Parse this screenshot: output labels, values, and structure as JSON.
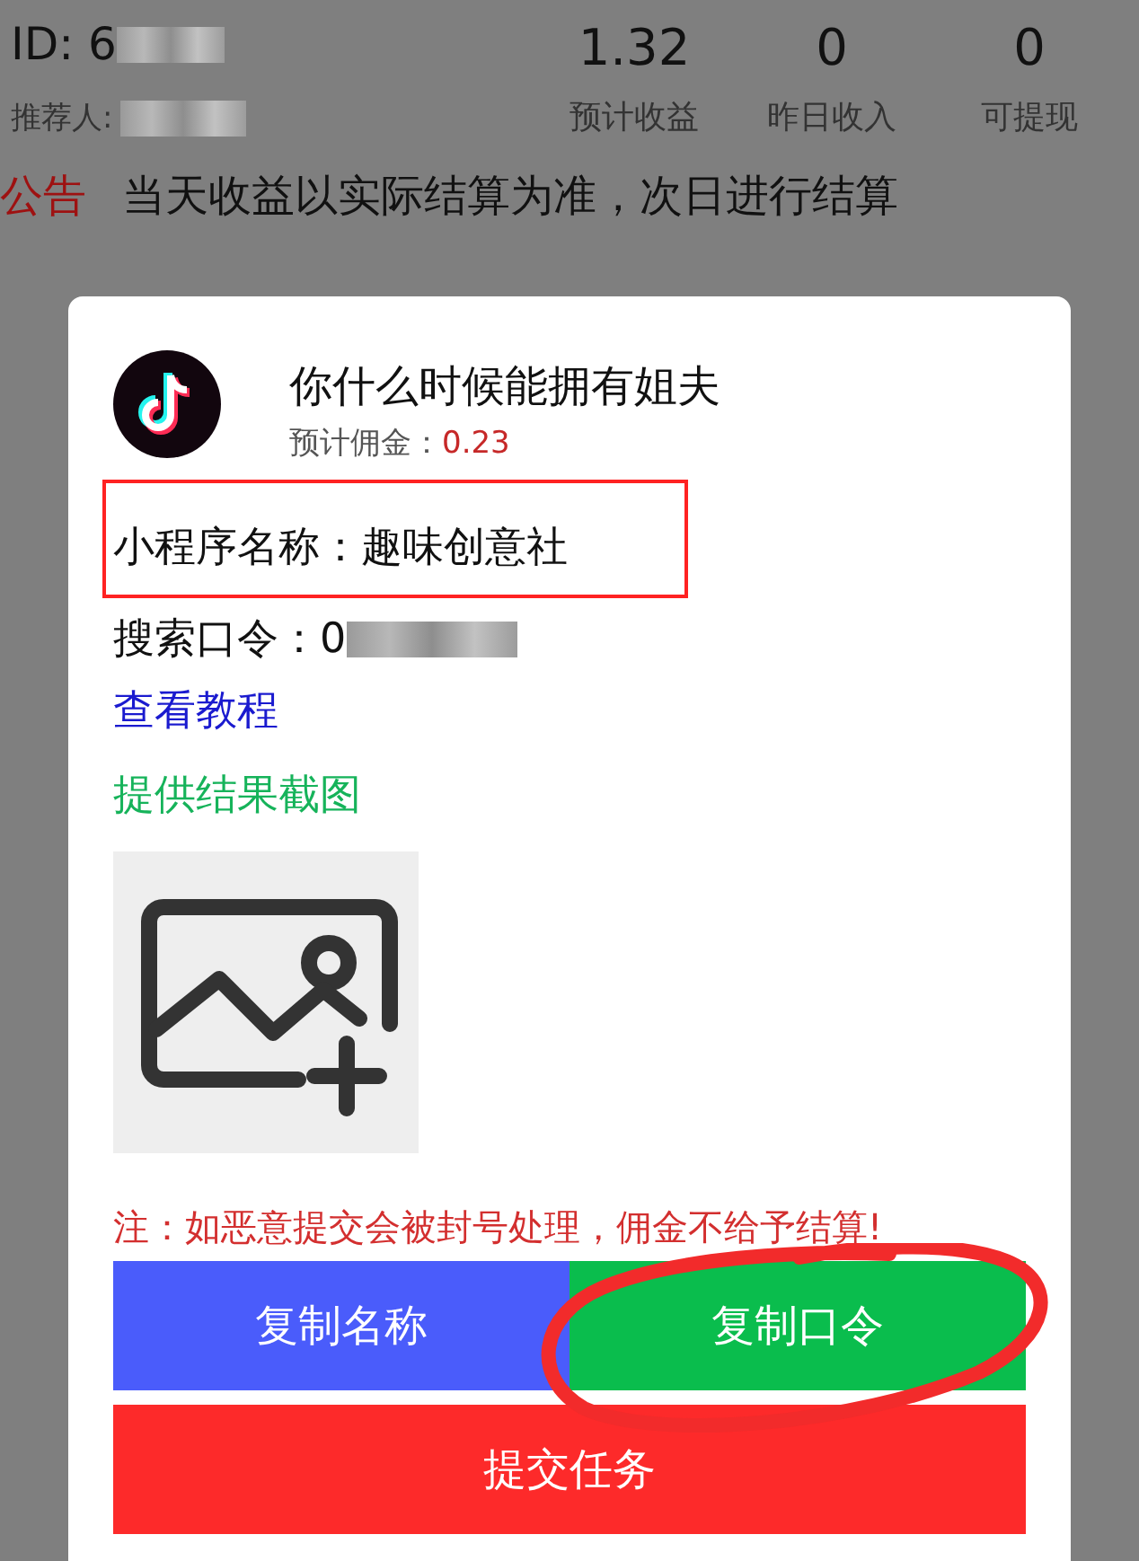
{
  "header": {
    "id_label": "ID: 6",
    "referrer_label": "推荐人:",
    "stats": [
      {
        "value": "1.32",
        "label": "预计收益"
      },
      {
        "value": "0",
        "label": "昨日收入"
      },
      {
        "value": "0",
        "label": "可提现"
      }
    ]
  },
  "notice": {
    "tag": "公告",
    "text": "当天收益以实际结算为准，次日进行结算"
  },
  "dialog": {
    "title": "你什么时候能拥有姐夫",
    "commission_label": "预计佣金：",
    "commission_value": "0.23",
    "mini_program": "小程序名称：趣味创意社",
    "search_code": "搜索口令：0",
    "tutorial_link": "查看教程",
    "upload_label": "提供结果截图",
    "note": "注：如恶意提交会被封号处理，佣金不给予结算!",
    "buttons": [
      {
        "label": "复制名称",
        "kind": "blue"
      },
      {
        "label": "复制口令",
        "kind": "green"
      },
      {
        "label": "提交任务",
        "kind": "red"
      }
    ]
  }
}
